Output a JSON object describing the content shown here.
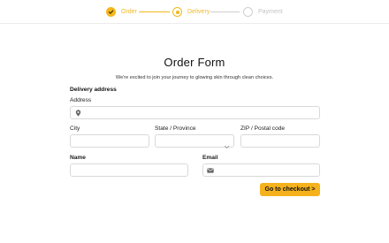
{
  "stepper": {
    "steps": [
      {
        "label": "Order",
        "state": "done"
      },
      {
        "label": "Delivery",
        "state": "active"
      },
      {
        "label": "Payment",
        "state": "todo"
      }
    ],
    "accent_color": "#f3b71c",
    "inactive_color": "#cfcfcf"
  },
  "form": {
    "title": "Order Form",
    "subtitle": "We're excited to join your journey to glowing skin through clean choices.",
    "section_title": "Delivery address",
    "address": {
      "label": "Address",
      "value": "",
      "icon": "map-pin-icon"
    },
    "city": {
      "label": "City",
      "value": ""
    },
    "state": {
      "label": "State / Province",
      "value": ""
    },
    "zip": {
      "label": "ZIP / Postal code",
      "value": ""
    },
    "name": {
      "label": "Name",
      "value": ""
    },
    "email": {
      "label": "Email",
      "value": "",
      "icon": "mail-icon"
    },
    "submit_label": "Go to checkout >"
  }
}
